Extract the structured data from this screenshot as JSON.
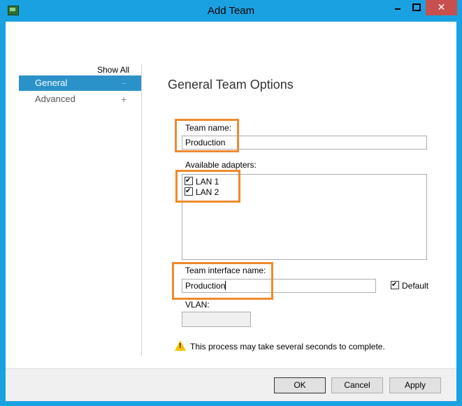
{
  "window": {
    "title": "Add Team",
    "controls": {
      "minimize": "minimize",
      "maximize": "maximize",
      "close": "✕"
    }
  },
  "nav": {
    "show_all": "Show All",
    "items": [
      {
        "label": "General",
        "sign": "−",
        "selected": true
      },
      {
        "label": "Advanced",
        "sign": "+",
        "selected": false
      }
    ]
  },
  "main": {
    "section_title": "General Team Options",
    "team_name_label": "Team name:",
    "team_name_value": "Production",
    "available_adapters_label": "Available adapters:",
    "adapters": [
      {
        "label": "LAN 1",
        "checked": true
      },
      {
        "label": "LAN 2",
        "checked": true
      }
    ],
    "team_interface_label": "Team interface name:",
    "team_interface_value": "Production",
    "default_label": "Default",
    "default_checked": true,
    "vlan_label": "VLAN:",
    "vlan_value": "",
    "warning_text": "This process may take several seconds to complete."
  },
  "buttons": {
    "ok": "OK",
    "cancel": "Cancel",
    "apply": "Apply"
  },
  "colors": {
    "window_border": "#1aa1e1",
    "selected_nav": "#2b91c9",
    "highlight": "#ef8a2e",
    "close_button": "#c7504f",
    "warning": "#f5c400"
  }
}
